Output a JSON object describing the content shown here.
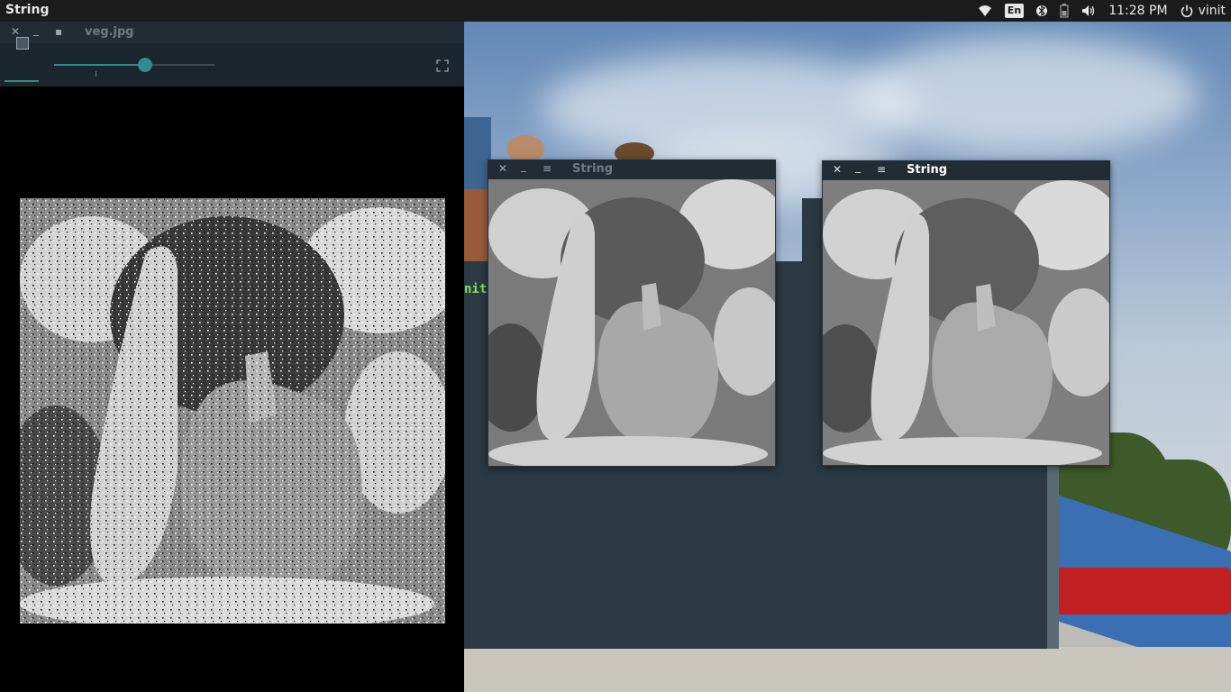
{
  "panel": {
    "app_title": "String",
    "keyboard_layout": "En",
    "clock": "11:28 PM",
    "user": "vinit",
    "icons": [
      "wifi-icon",
      "keyboard-icon",
      "bluetooth-icon",
      "battery-icon",
      "volume-icon",
      "power-icon"
    ]
  },
  "viewer": {
    "title": "veg.jpg",
    "zoom_slider_fraction": 0.57
  },
  "windows": [
    {
      "title": "String",
      "active": false
    },
    {
      "title": "String",
      "active": true
    }
  ],
  "terminal": {
    "visible_text": "nit"
  },
  "colors": {
    "accent": "#2f8d8a",
    "panel_bg": "#1b1b1b",
    "titlebar_bg": "#222c35",
    "inactive_title": "#6e7b86",
    "active_title": "#ffffff",
    "terminal_green": "#7fe35a"
  }
}
